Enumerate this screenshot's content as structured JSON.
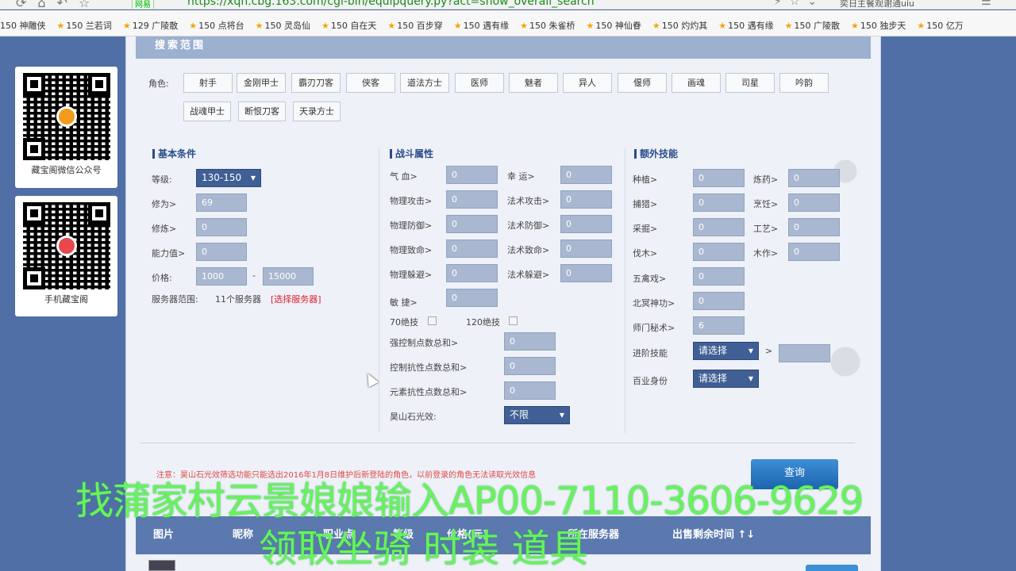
{
  "browser": {
    "secure_label": "网易",
    "url": "https://xqn.cbg.163.com/cgi-bin/equipquery.py?act=show_overall_search",
    "search_text": "奕日主餐观谢通uiu",
    "bookmarks": [
      "150 神雕侠",
      "150 兰若词",
      "129 广陵散",
      "150 点将台",
      "150 灵岛仙",
      "150 自在天",
      "150 百步穿",
      "150 遇有缘",
      "150 朱雀桥",
      "150 神仙眷",
      "150 灼灼其",
      "150 遇有缘",
      "150 广陵散",
      "150 独步天",
      "150 亿万"
    ]
  },
  "left_cards": [
    {
      "caption": "藏宝阁微信公众号"
    },
    {
      "caption": "手机藏宝阁"
    }
  ],
  "panel": {
    "section_title": "搜索范围",
    "role_label": "角色:",
    "roles": [
      "射手",
      "金刚甲士",
      "霸刃刀客",
      "侠客",
      "道法方士",
      "医师",
      "魅者",
      "异人",
      "偃师",
      "画魂",
      "司星",
      "吟韵",
      "战魂甲士",
      "断恨刀客",
      "天录方士"
    ],
    "basic": {
      "title": "基本条件",
      "level_label": "等级:",
      "level_value": "130-150",
      "xiuwei_label": "修为>",
      "xiuwei_value": "69",
      "xiulian_label": "修炼>",
      "xiulian_value": "0",
      "ability_label": "能力值>",
      "ability_value": "0",
      "price_label": "价格:",
      "price_min": "1000",
      "price_sep": "-",
      "price_max": "15000",
      "server_label": "服务器范围:",
      "server_count": "11个服务器",
      "server_link": "[选择服务器]"
    },
    "battle": {
      "title": "战斗属性",
      "fields": [
        {
          "label": "气  血>",
          "value": "0",
          "label2": "幸  运>",
          "value2": "0"
        },
        {
          "label": "物理攻击>",
          "value": "0",
          "label2": "法术攻击>",
          "value2": "0"
        },
        {
          "label": "物理防御>",
          "value": "0",
          "label2": "法术防御>",
          "value2": "0"
        },
        {
          "label": "物理致命>",
          "value": "0",
          "label2": "法术致命>",
          "value2": "0"
        },
        {
          "label": "物理躲避>",
          "value": "0",
          "label2": "法术躲避>",
          "value2": "0"
        }
      ],
      "agility_label": "敏  捷>",
      "agility_value": "0",
      "skill70": "70绝技",
      "skill120": "120绝技",
      "control_total_label": "强控制点数总和>",
      "control_total_value": "0",
      "control_resist_label": "控制抗性点数总和>",
      "control_resist_value": "0",
      "element_resist_label": "元素抗性点数总和>",
      "element_resist_value": "0",
      "stone_label": "昊山石光效:",
      "stone_value": "不限"
    },
    "extra": {
      "title": "额外技能",
      "rows": [
        {
          "label": "种植>",
          "value": "0",
          "label2": "炼药>",
          "value2": "0"
        },
        {
          "label": "捕猎>",
          "value": "0",
          "label2": "烹饪>",
          "value2": "0"
        },
        {
          "label": "采掘>",
          "value": "0",
          "label2": "工艺>",
          "value2": "0"
        },
        {
          "label": "伐木>",
          "value": "0",
          "label2": "木作>",
          "value2": "0"
        }
      ],
      "wuqin_label": "五禽戏>",
      "wuqin_value": "0",
      "beiming_label": "北冥神功>",
      "beiming_value": "0",
      "shimen_label": "师门秘术>",
      "shimen_value": "6",
      "advanced_label": "进阶技能",
      "advanced_value": "请选择",
      "advanced_gt": ">",
      "baiye_label": "百业身份",
      "baiye_value": "请选择"
    },
    "notice": "注意：昊山石光效筛选功能只能选出2016年1月8日维护后新登陆的角色，以前登录的角色无法读取光效信息",
    "query_button": "查询",
    "table_headers": [
      "图片",
      "昵称",
      "职业点",
      "等级",
      "价格(元)",
      "所在服务器",
      "出售剩余时间 ↑↓"
    ]
  },
  "overlay": {
    "line1": "找蒲家村云景娘娘输入AP00-7110-3606-9629",
    "line2": "领取坐骑 时装 道具"
  }
}
